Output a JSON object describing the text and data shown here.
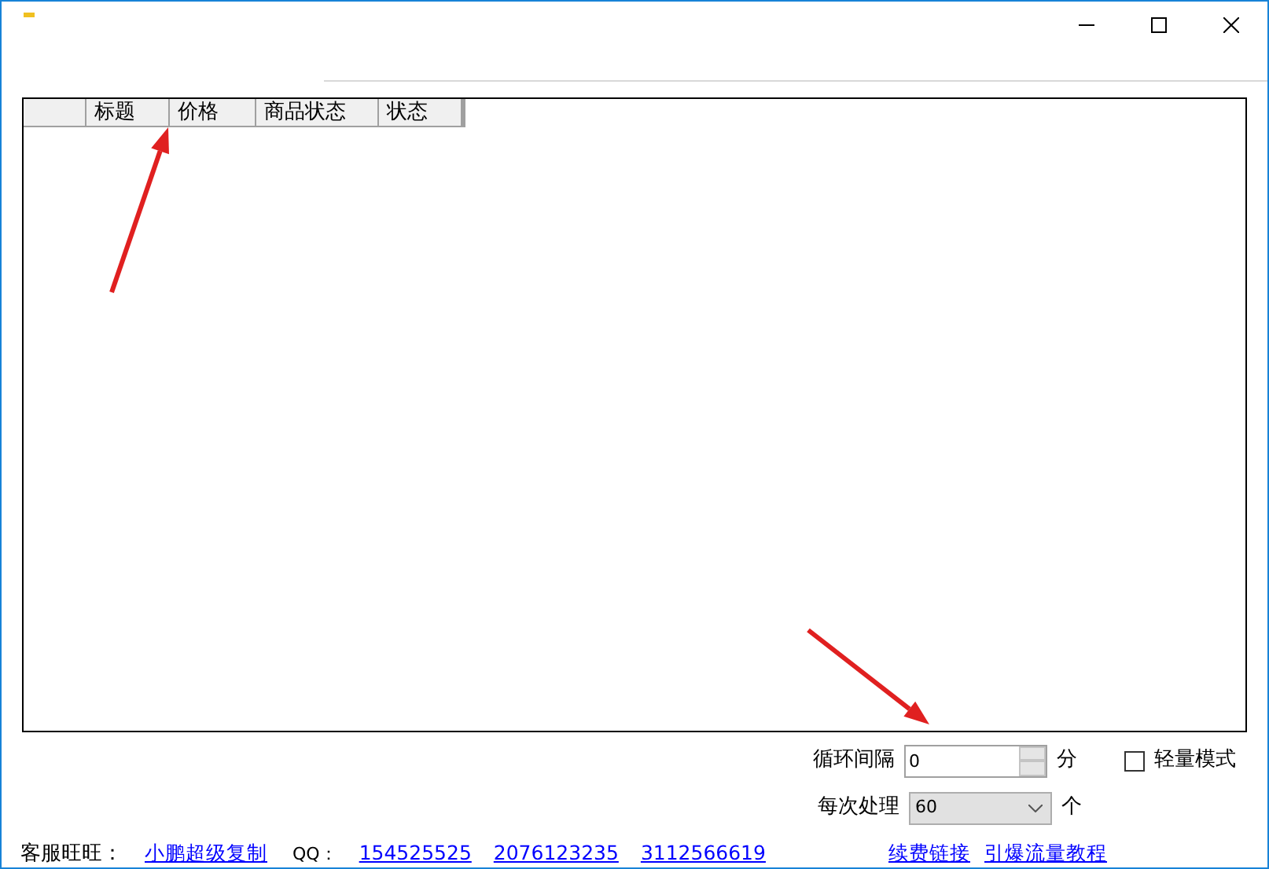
{
  "window": {
    "controls": [
      {
        "kind": "minimize"
      },
      {
        "kind": "maximize"
      },
      {
        "kind": "close"
      }
    ]
  },
  "table": {
    "columns": [
      {},
      {
        "label": "标题"
      },
      {
        "label": "价格"
      },
      {
        "label": "商品状态"
      },
      {
        "label": "状态"
      }
    ]
  },
  "settings": {
    "interval": {
      "label": "循环间隔",
      "value": "0",
      "unit": "分"
    },
    "light_mode": {
      "label": "轻量模式",
      "checked": false
    },
    "batch": {
      "label": "每次处理",
      "value": "60",
      "unit": "个"
    }
  },
  "footer": {
    "wangwang_label": "客服旺旺：",
    "wangwang_link": "小鹏超级复制",
    "qq_label": "QQ：",
    "qq_links": [
      "154525525",
      "2076123235",
      "3112566619"
    ],
    "links": [
      "续费链接",
      "引爆流量教程"
    ]
  },
  "annotations": [
    {
      "kind": "arrow"
    },
    {
      "kind": "arrow"
    }
  ]
}
